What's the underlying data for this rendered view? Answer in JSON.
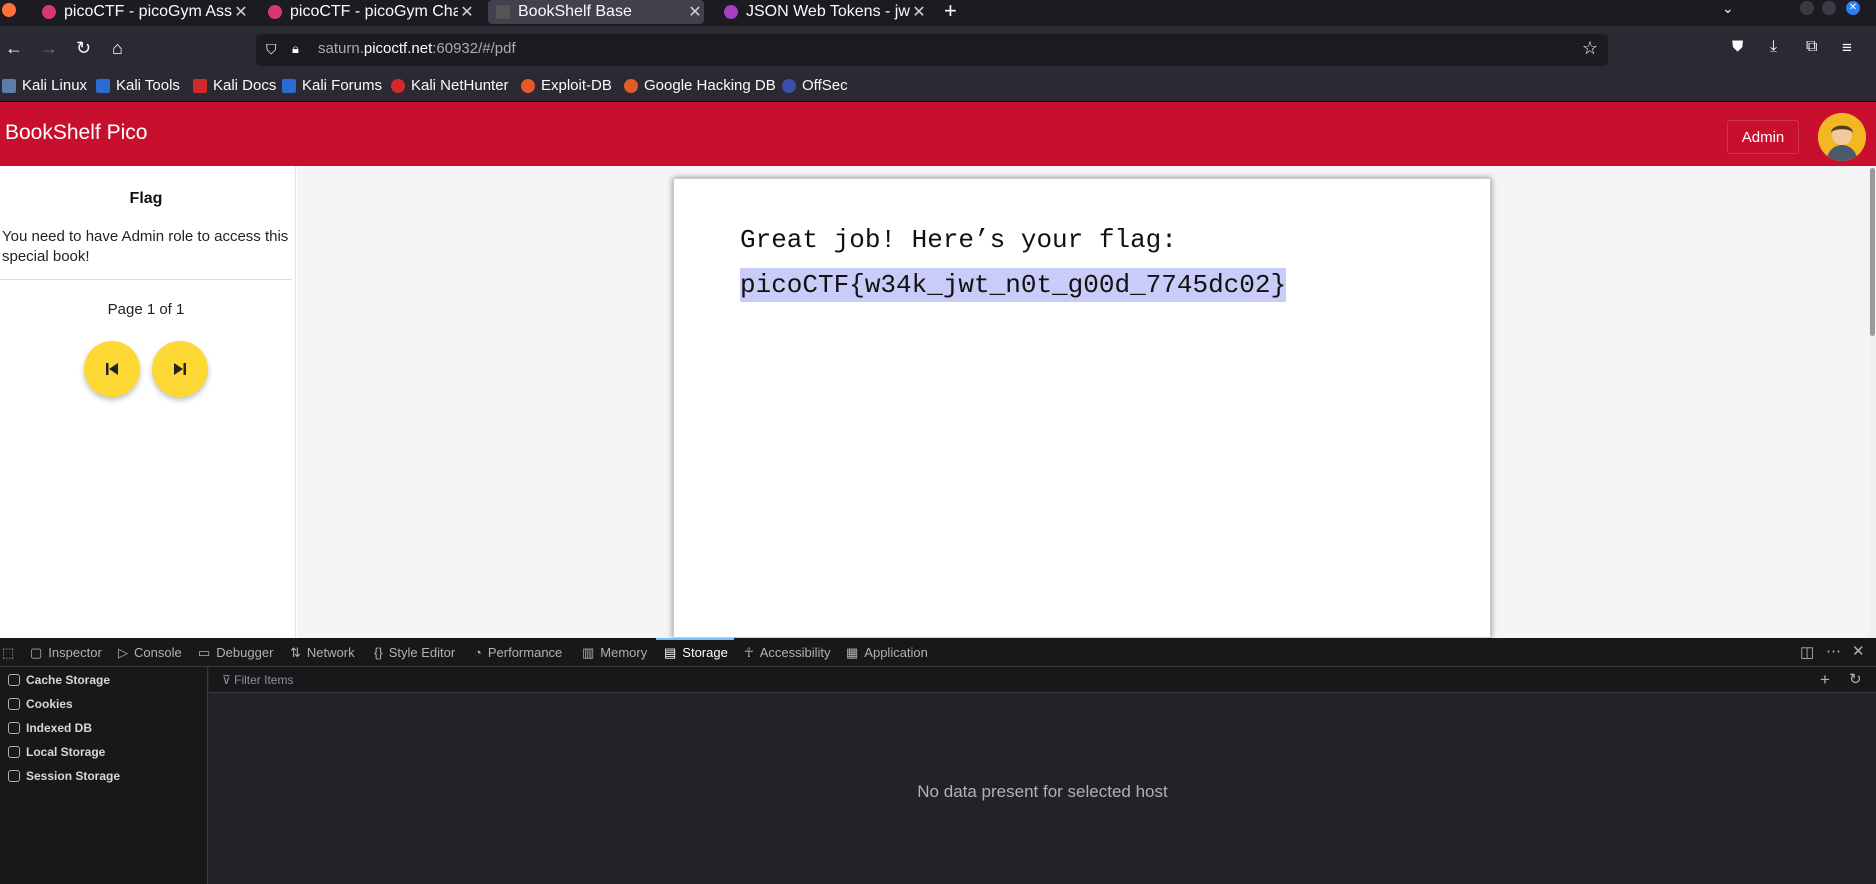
{
  "browser": {
    "tabs": [
      {
        "label": "picoCTF - picoGym Assignments",
        "active": false
      },
      {
        "label": "picoCTF - picoGym Challenges",
        "active": false
      },
      {
        "label": "BookShelf Base",
        "active": true
      },
      {
        "label": "JSON Web Tokens - jwt.io",
        "active": false
      }
    ],
    "url_prefix": "saturn.",
    "url_domain": "picoctf.net",
    "url_suffix": ":60932/#/pdf",
    "bookmarks": [
      "Kali Linux",
      "Kali Tools",
      "Kali Docs",
      "Kali Forums",
      "Kali NetHunter",
      "Exploit-DB",
      "Google Hacking DB",
      "OffSec"
    ]
  },
  "app": {
    "title": "BookShelf Pico",
    "admin_label": "Admin",
    "sidebar": {
      "title": "Flag",
      "description": "You need to have Admin role to access this special book!",
      "page_label": "Page 1 of 1"
    },
    "pdf": {
      "line1": "Great job! Here’s your flag:",
      "flag": "picoCTF{w34k_jwt_n0t_g00d_7745dc02}"
    }
  },
  "devtools": {
    "tabs": [
      "Inspector",
      "Console",
      "Debugger",
      "Network",
      "Style Editor",
      "Performance",
      "Memory",
      "Storage",
      "Accessibility",
      "Application"
    ],
    "selected_tab": "Storage",
    "storage_items": [
      "Cache Storage",
      "Cookies",
      "Indexed DB",
      "Local Storage",
      "Session Storage"
    ],
    "filter_placeholder": "Filter Items",
    "empty_message": "No data present for selected host"
  },
  "colors": {
    "brand_red": "#c8102e",
    "button_yellow": "#fdd835",
    "highlight": "#c9cbf8",
    "devtools_accent": "#75bfff"
  }
}
